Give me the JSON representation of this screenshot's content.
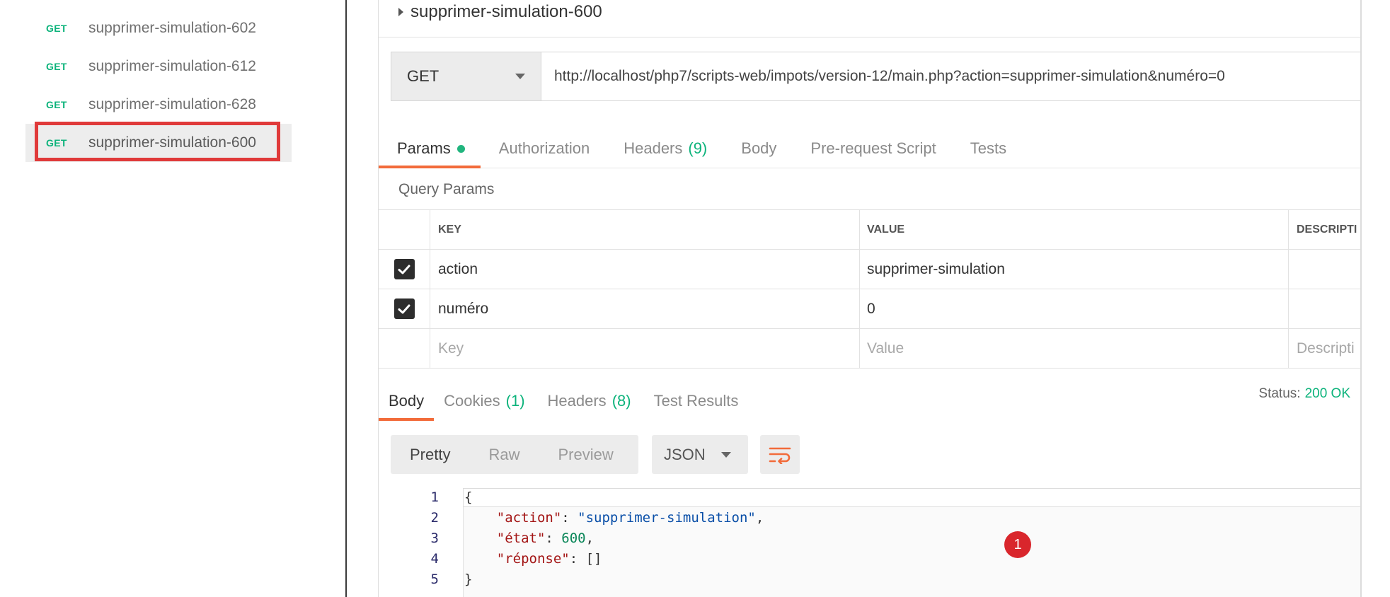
{
  "sidebar": {
    "items": [
      {
        "method": "GET",
        "name": "supprimer-simulation-602"
      },
      {
        "method": "GET",
        "name": "supprimer-simulation-612"
      },
      {
        "method": "GET",
        "name": "supprimer-simulation-628"
      },
      {
        "method": "GET",
        "name": "supprimer-simulation-600"
      }
    ]
  },
  "request": {
    "title": "supprimer-simulation-600",
    "method": "GET",
    "url": "http://localhost/php7/scripts-web/impots/version-12/main.php?action=supprimer-simulation&numéro=0"
  },
  "request_tabs": [
    {
      "label": "Params",
      "count": ""
    },
    {
      "label": "Authorization",
      "count": ""
    },
    {
      "label": "Headers",
      "count": "(9)"
    },
    {
      "label": "Body",
      "count": ""
    },
    {
      "label": "Pre-request Script",
      "count": ""
    },
    {
      "label": "Tests",
      "count": ""
    }
  ],
  "query_params": {
    "label": "Query Params",
    "headers": {
      "key": "KEY",
      "value": "VALUE",
      "description": "DESCRIPTI"
    },
    "rows": [
      {
        "key": "action",
        "value": "supprimer-simulation",
        "checked": true
      },
      {
        "key": "numéro",
        "value": "0",
        "checked": true
      }
    ],
    "placeholders": {
      "key": "Key",
      "value": "Value",
      "description": "Descripti"
    }
  },
  "response_tabs": [
    {
      "label": "Body",
      "count": ""
    },
    {
      "label": "Cookies",
      "count": "(1)"
    },
    {
      "label": "Headers",
      "count": "(8)"
    },
    {
      "label": "Test Results",
      "count": ""
    }
  ],
  "status": {
    "label": "Status:",
    "value": "200 OK"
  },
  "format": {
    "views": [
      "Pretty",
      "Raw",
      "Preview"
    ],
    "language": "JSON"
  },
  "code": {
    "line_numbers": [
      "1",
      "2",
      "3",
      "4",
      "5"
    ],
    "open_brace": "{",
    "close_brace": "}",
    "line2_key": "\"action\"",
    "line2_value": "\"supprimer-simulation\"",
    "line3_key": "\"état\"",
    "line3_value": "600",
    "line4_key": "\"réponse\"",
    "line4_value": "[]"
  },
  "annotation_badge": "1",
  "colors": {
    "accent": "#f26b3a",
    "get": "#0cb37b",
    "highlight": "#e03a3a",
    "badge": "#d9262c"
  }
}
